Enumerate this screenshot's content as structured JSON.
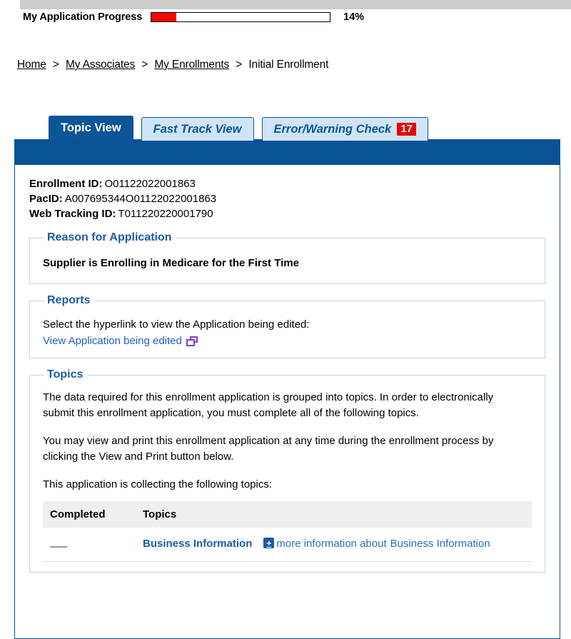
{
  "progress": {
    "label": "My Application Progress",
    "percent_text": "14%",
    "percent_value": 14,
    "fill_color": "#fe0000"
  },
  "breadcrumb": {
    "items": [
      {
        "label": "Home",
        "link": true
      },
      {
        "label": "My Associates",
        "link": true
      },
      {
        "label": "My Enrollments",
        "link": true
      },
      {
        "label": "Initial Enrollment",
        "link": false
      }
    ],
    "separator": ">"
  },
  "tabs": [
    {
      "label": "Topic View",
      "active": true
    },
    {
      "label": "Fast Track View",
      "active": false
    },
    {
      "label": "Error/Warning Check",
      "active": false,
      "badge": "17"
    }
  ],
  "identifiers": [
    {
      "label": "Enrollment ID:",
      "value": "O01122022001863"
    },
    {
      "label": "PacID:",
      "value": "A007695344O01122022001863"
    },
    {
      "label": "Web Tracking ID:",
      "value": "T011220220001790"
    }
  ],
  "reason_section": {
    "legend": "Reason for Application",
    "value": "Supplier is Enrolling in Medicare for the First Time"
  },
  "reports_section": {
    "legend": "Reports",
    "instruction": "Select the hyperlink to view the Application being edited:",
    "link_label": "View Application being edited",
    "link_icon": "new-window-icon"
  },
  "topics_section": {
    "legend": "Topics",
    "paragraphs": [
      "The data required for this enrollment application is grouped into topics. In order to electronically submit this enrollment application, you must complete all of the following topics.",
      "You may view and print this enrollment application at any time during the enrollment process by clicking the View and Print button below.",
      "This application is collecting the following topics:"
    ],
    "table": {
      "headers": [
        "Completed",
        "Topics"
      ],
      "rows": [
        {
          "completed": "—",
          "topic": "Business Information",
          "more_info_icon": "plus-icon",
          "more_info_prefix": "more information about",
          "more_info_topic": "Business Information"
        }
      ]
    }
  },
  "colors": {
    "panel_blue": "#0a5296",
    "tab_active_blue": "#0c5596",
    "tab_inactive_blue": "#cfe4f5",
    "badge_red": "#e60000",
    "legend_blue": "#1b5ca8",
    "link_blue": "#2a6ebb",
    "top_strip_gray": "#cccccc"
  }
}
